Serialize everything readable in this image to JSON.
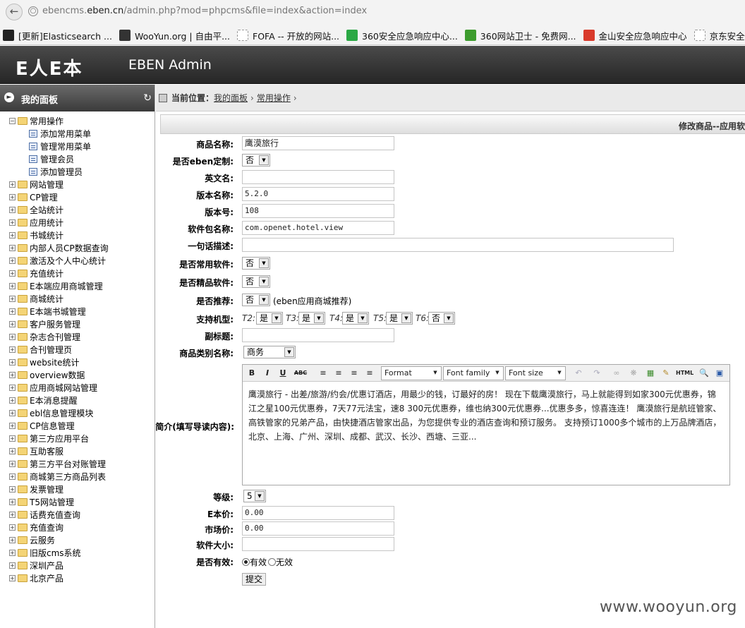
{
  "browser": {
    "url_prefix": "ebencms.",
    "url_domain": "eben.cn",
    "url_rest": "/admin.php?mod=phpcms&file=index&action=index",
    "bookmarks": [
      {
        "label": "[更新]Elasticsearch ...",
        "icon": "elastic-icon",
        "color": "#222222"
      },
      {
        "label": "WooYun.org | 自由平...",
        "icon": "wooyun-icon",
        "color": "#333333"
      },
      {
        "label": "FOFA -- 开放的网站...",
        "icon": "page-icon",
        "color": "#ffffff"
      },
      {
        "label": "360安全应急响应中心...",
        "icon": "360-icon",
        "color": "#2aa844"
      },
      {
        "label": "360网站卫士 - 免费网...",
        "icon": "shield-icon",
        "color": "#3d9c2e"
      },
      {
        "label": "金山安全应急响应中心",
        "icon": "kingsoft-icon",
        "color": "#d93a2b"
      },
      {
        "label": "京东安全应急响应中心",
        "icon": "page-icon",
        "color": "#ffffff"
      }
    ]
  },
  "header": {
    "logo": "E人E本",
    "title": "EBEN Admin"
  },
  "sidebar": {
    "title": "我的面板",
    "tree": [
      {
        "label": "常用操作",
        "expanded": true,
        "children": [
          "添加常用菜单",
          "管理常用菜单",
          "管理会员",
          "添加管理员"
        ]
      },
      {
        "label": "网站管理"
      },
      {
        "label": "CP管理"
      },
      {
        "label": "全站统计"
      },
      {
        "label": "应用统计"
      },
      {
        "label": "书城统计"
      },
      {
        "label": "内部人员CP数据查询"
      },
      {
        "label": "激活及个人中心统计"
      },
      {
        "label": "充值统计"
      },
      {
        "label": "E本端应用商城管理"
      },
      {
        "label": "商城统计"
      },
      {
        "label": "E本端书城管理"
      },
      {
        "label": "客户服务管理"
      },
      {
        "label": "杂志合刊管理"
      },
      {
        "label": "合刊管理页"
      },
      {
        "label": "website统计"
      },
      {
        "label": "overview数据"
      },
      {
        "label": "应用商城网站管理"
      },
      {
        "label": "E本消息提醒"
      },
      {
        "label": "ebl信息管理模块"
      },
      {
        "label": "CP信息管理"
      },
      {
        "label": "第三方应用平台"
      },
      {
        "label": "互助客服"
      },
      {
        "label": "第三方平台对账管理"
      },
      {
        "label": "商城第三方商品列表"
      },
      {
        "label": "发票管理"
      },
      {
        "label": "T5网站管理"
      },
      {
        "label": "话费充值查询"
      },
      {
        "label": "充值查询"
      },
      {
        "label": "云服务"
      },
      {
        "label": "旧版cms系统"
      },
      {
        "label": "深圳产品"
      },
      {
        "label": "北京产品"
      }
    ]
  },
  "breadcrumb": {
    "label": "当前位置：",
    "items": [
      "我的面板",
      "常用操作"
    ]
  },
  "form": {
    "title": "修改商品--应用软",
    "product_name": {
      "label": "商品名称:",
      "value": "鹰漠旅行"
    },
    "eben_custom": {
      "label": "是否eben定制:",
      "value": "否"
    },
    "english_name": {
      "label": "英文名:",
      "value": ""
    },
    "version_name": {
      "label": "版本名称:",
      "value": "5.2.0"
    },
    "version_no": {
      "label": "版本号:",
      "value": "108"
    },
    "package_name": {
      "label": "软件包名称:",
      "value": "com.openet.hotel.view"
    },
    "one_line_desc": {
      "label": "一句话描述:",
      "value": ""
    },
    "common_soft": {
      "label": "是否常用软件:",
      "value": "否"
    },
    "featured_soft": {
      "label": "是否精品软件:",
      "value": "否"
    },
    "recommend": {
      "label": "是否推荐:",
      "value": "否",
      "note": "(eben应用商城推荐)"
    },
    "models": {
      "label": "支持机型:",
      "items": [
        {
          "name": "T2:",
          "value": "是"
        },
        {
          "name": "T3:",
          "value": "是"
        },
        {
          "name": "T4:",
          "value": "是"
        },
        {
          "name": "T5:",
          "value": "是"
        },
        {
          "name": "T6:",
          "value": "否"
        }
      ]
    },
    "subtitle": {
      "label": "副标题:",
      "value": ""
    },
    "category": {
      "label": "商品类别名称:",
      "value": "商务"
    },
    "intro": {
      "label": "简介(填写导读内容):",
      "toolbar": {
        "format": "Format",
        "font_family": "Font family",
        "font_size": "Font size",
        "html": "HTML"
      },
      "text": "鹰漠旅行 - 出差/旅游/约会/优惠订酒店，用最少的钱，订最好的房！ 现在下载鹰漠旅行，马上就能得到如家300元优惠券，锦江之星100元优惠券，7天77元法宝，速8  300元优惠券，维也纳300元优惠券...优惠多多，惊喜连连！ 鹰漠旅行是航班管家、高铁管家的兄弟产品，由快捷酒店管家出品，为您提供专业的酒店查询和预订服务。 支持预订1000多个城市的上万品牌酒店，北京、上海、广州、深圳、成都、武汉、长沙、西塘、三亚..."
    },
    "level": {
      "label": "等级:",
      "value": "5"
    },
    "e_price": {
      "label": "E本价:",
      "value": "0.00"
    },
    "market_price": {
      "label": "市场价:",
      "value": "0.00"
    },
    "soft_size": {
      "label": "软件大小:",
      "value": ""
    },
    "valid": {
      "label": "是否有效:",
      "option_yes": "有效",
      "option_no": "无效",
      "selected": "有效"
    },
    "submit_label": "提交"
  },
  "watermark": "www.wooyun.org"
}
